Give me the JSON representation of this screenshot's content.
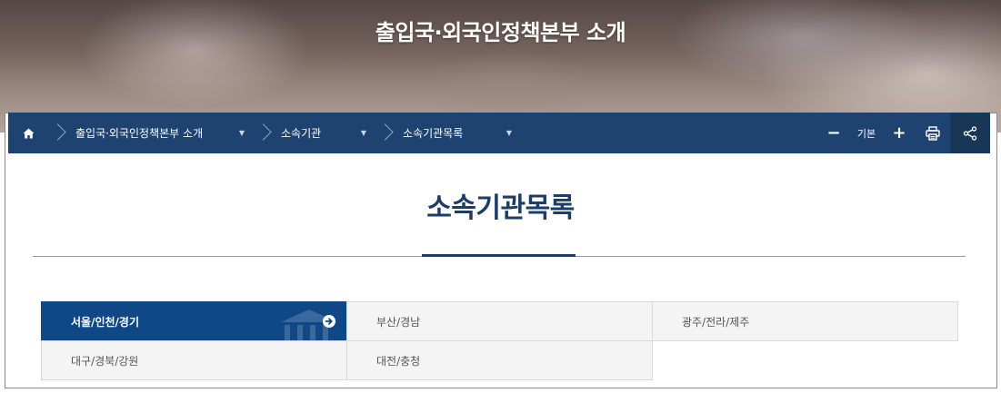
{
  "hero": {
    "title": "출입국·외국인정책본부 소개"
  },
  "breadcrumb": {
    "home_icon": "home-icon",
    "items": [
      {
        "label": "출입국·외국인정책본부 소개",
        "icon": "caret-down-icon"
      },
      {
        "label": "소속기관",
        "icon": "caret-down-icon"
      },
      {
        "label": "소속기관목록",
        "icon": "caret-down-icon"
      }
    ]
  },
  "tools": {
    "zoom_out": "−",
    "zoom_label": "기본",
    "zoom_in": "+",
    "print_icon": "printer-icon",
    "share_icon": "share-icon"
  },
  "page": {
    "title": "소속기관목록"
  },
  "regions": [
    {
      "label": "서울/인천/경기",
      "active": true
    },
    {
      "label": "부산/경남",
      "active": false
    },
    {
      "label": "광주/전라/제주",
      "active": false
    },
    {
      "label": "대구/경북/강원",
      "active": false
    },
    {
      "label": "대전/충청",
      "active": false
    }
  ],
  "colors": {
    "navbar": "#1f4370",
    "active_tab": "#104786",
    "title": "#1b3d66"
  }
}
